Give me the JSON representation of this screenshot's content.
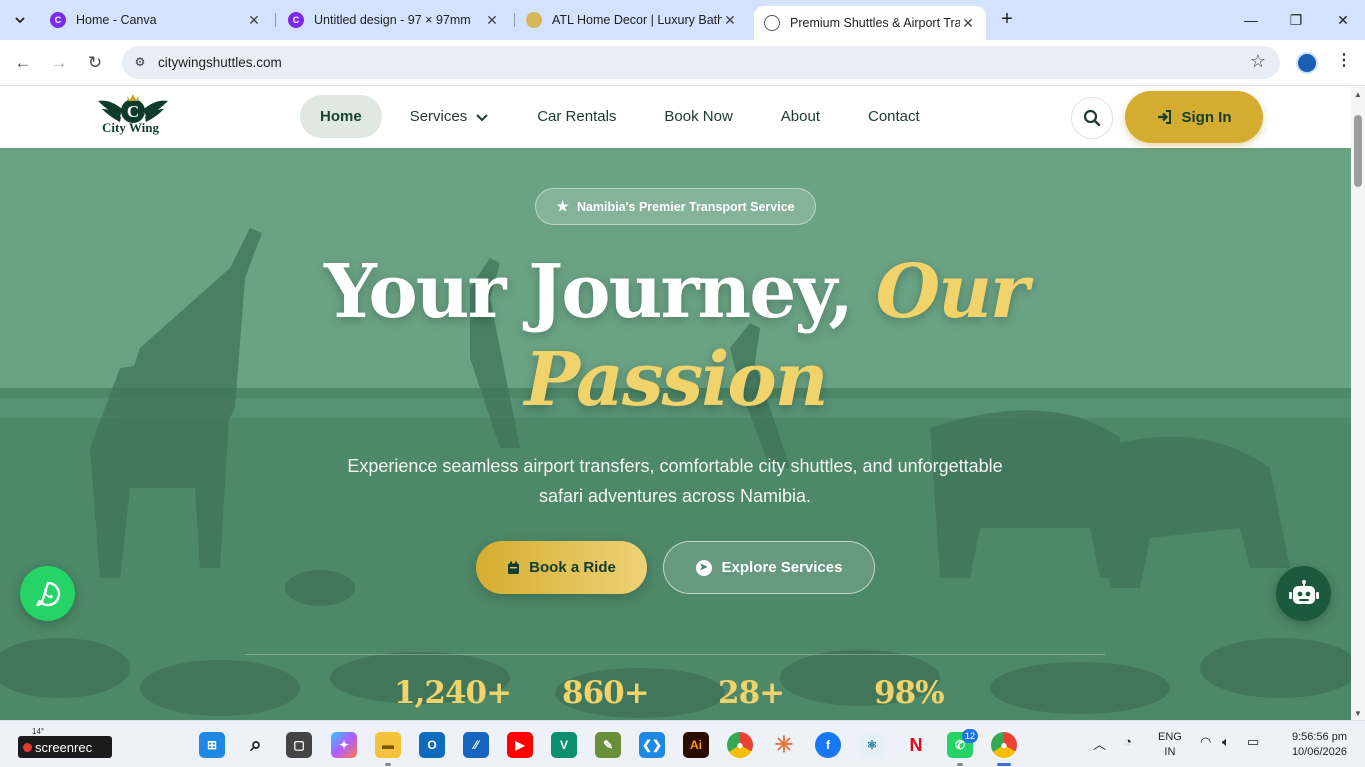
{
  "browser": {
    "tabs": [
      {
        "title": "Home - Canva",
        "favicon": "canva-icon",
        "active": false
      },
      {
        "title": "Untitled design - 97 × 97mm",
        "favicon": "canva-icon",
        "active": false
      },
      {
        "title": "ATL Home Decor | Luxury Bathr",
        "favicon": "atl-icon",
        "active": false
      },
      {
        "title": "Premium Shuttles & Airport Tra",
        "favicon": "globe-icon",
        "active": true
      }
    ],
    "url": "citywingshuttles.com"
  },
  "site": {
    "logo_text": "City Wing",
    "logo_letter": "C",
    "nav": {
      "home": "Home",
      "services": "Services",
      "car_rentals": "Car Rentals",
      "book_now": "Book Now",
      "about": "About",
      "contact": "Contact"
    },
    "signin_label": "Sign In",
    "hero": {
      "badge": "Namibia's Premier Transport Service",
      "headline_white": "Your Journey,",
      "headline_gold_1": "Our",
      "headline_gold_2": "Passion",
      "subtitle": "Experience seamless airport transfers, comfortable city shuttles, and unforgettable safari adventures across Namibia.",
      "book_label": "Book a Ride",
      "explore_label": "Explore Services",
      "stats": [
        "1,240+",
        "860+",
        "28+",
        "98%"
      ]
    },
    "colors": {
      "brand_green": "#1b4332",
      "gold": "#d4ac2f",
      "hero_overlay": "#4a8566",
      "whatsapp": "#25d366"
    }
  },
  "taskbar": {
    "weather": "14°",
    "screenrec": "screenrec",
    "whatsapp_badge": "12",
    "lang_1": "ENG",
    "lang_2": "IN",
    "time": "9:56:56 pm",
    "date": "10/06/2026"
  }
}
